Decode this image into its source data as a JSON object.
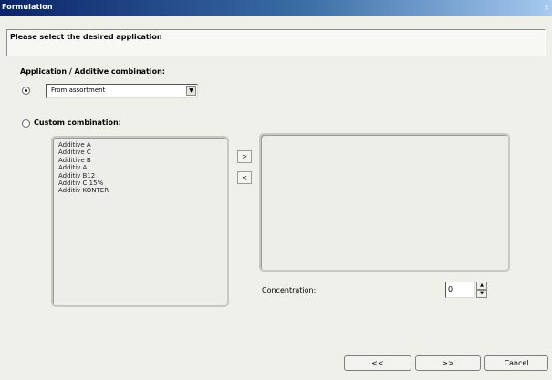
{
  "window": {
    "title": "Formulation",
    "close_label": "x"
  },
  "banner": {
    "text": "Please select the desired application"
  },
  "section": {
    "label": "Application / Additive combination:"
  },
  "options": {
    "assortment": {
      "selected": true,
      "value": "From assortment",
      "dropdown_glyph": "▼"
    },
    "custom": {
      "selected": false,
      "label": "Custom combination:"
    }
  },
  "available_list": {
    "items": [
      "Additive A",
      "Additive C",
      "Additive B",
      "Additiv A",
      "Additiv B12",
      "Additiv C 15%",
      "Additiv KONTER"
    ]
  },
  "transfer": {
    "add_label": ">",
    "remove_label": "<"
  },
  "selected_list": {
    "items": []
  },
  "concentration": {
    "label": "Concentration:",
    "value": "0",
    "up": "▲",
    "down": "▼"
  },
  "nav": {
    "back_label": "<<",
    "next_label": ">>",
    "cancel_label": "Cancel"
  }
}
